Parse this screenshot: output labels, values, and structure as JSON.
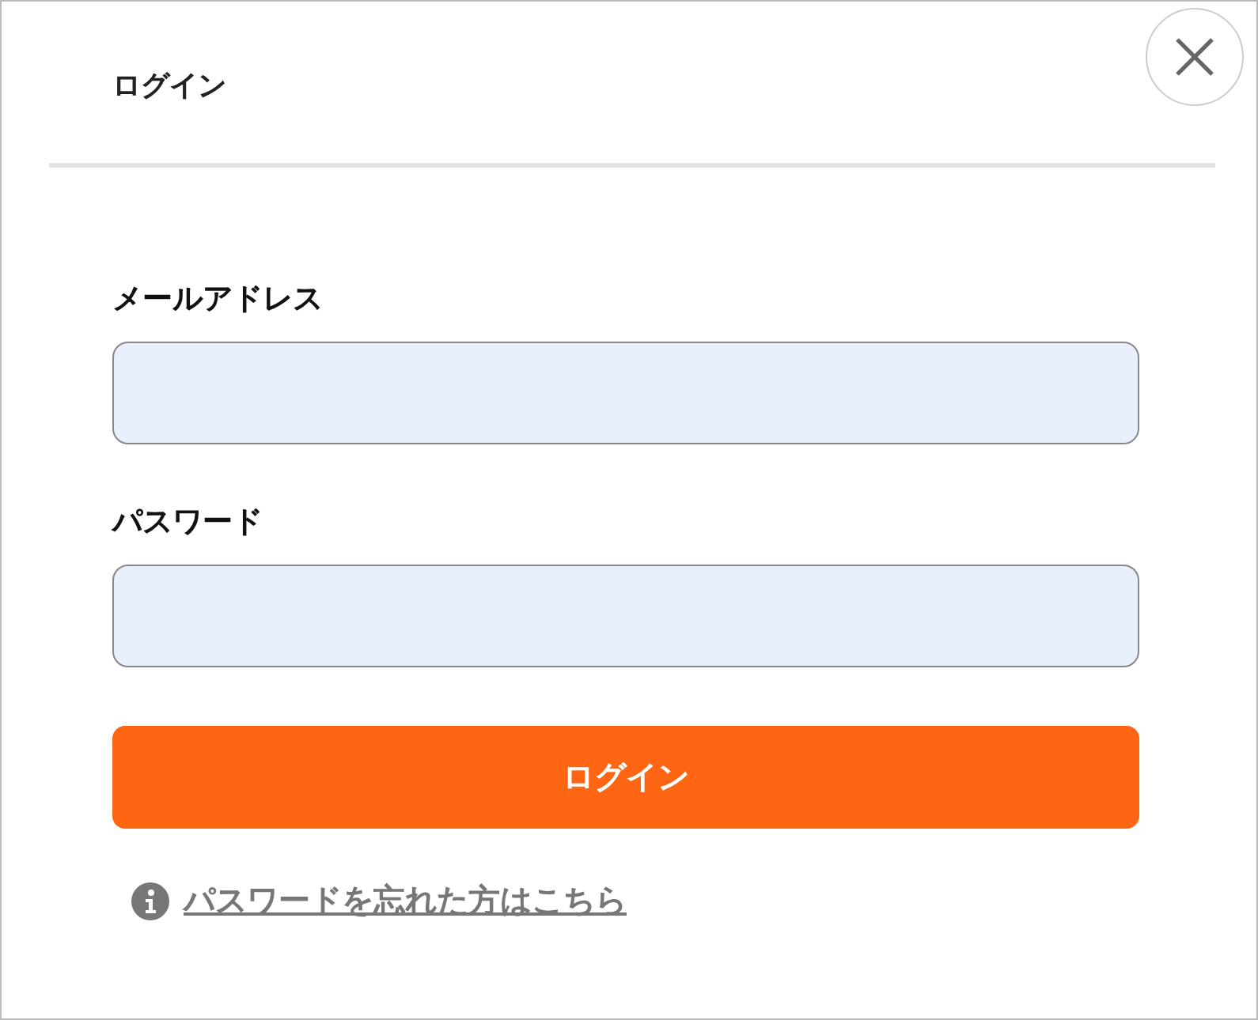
{
  "dialog": {
    "title": "ログイン"
  },
  "fields": [
    {
      "label": "メールアドレス"
    },
    {
      "label": "パスワード"
    }
  ],
  "submit_button": {
    "label": "ログイン"
  },
  "forgot_link": {
    "text": "パスワードを忘れた方はこちら"
  }
}
